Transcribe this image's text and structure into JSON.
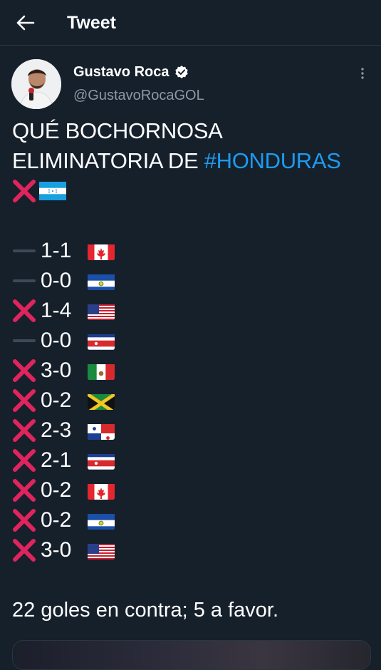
{
  "header": {
    "title": "Tweet",
    "back_icon": "arrow-left-icon"
  },
  "author": {
    "name": "Gustavo Roca",
    "handle": "@GustavoRocaGOL",
    "verified": true,
    "more_icon": "more-vertical-icon"
  },
  "tweet": {
    "line1": "QUÉ BOCHORNOSA",
    "line2_prefix": "ELIMINATORIA DE ",
    "hashtag": "#HONDURAS",
    "line3_icons": [
      "cross-mark-icon",
      "honduras-flag-icon"
    ],
    "results": [
      {
        "mark": "draw",
        "score": "1-1",
        "flag": "canada"
      },
      {
        "mark": "draw",
        "score": "0-0",
        "flag": "el-salvador"
      },
      {
        "mark": "loss",
        "score": "1-4",
        "flag": "usa"
      },
      {
        "mark": "draw",
        "score": "0-0",
        "flag": "costa-rica"
      },
      {
        "mark": "loss",
        "score": "3-0",
        "flag": "mexico"
      },
      {
        "mark": "loss",
        "score": "0-2",
        "flag": "jamaica"
      },
      {
        "mark": "loss",
        "score": "2-3",
        "flag": "panama"
      },
      {
        "mark": "loss",
        "score": "2-1",
        "flag": "costa-rica"
      },
      {
        "mark": "loss",
        "score": "0-2",
        "flag": "canada"
      },
      {
        "mark": "loss",
        "score": "0-2",
        "flag": "el-salvador"
      },
      {
        "mark": "loss",
        "score": "3-0",
        "flag": "usa"
      }
    ],
    "summary": "22 goles en contra; 5 a favor."
  },
  "colors": {
    "background": "#15202b",
    "text": "#ffffff",
    "secondary": "#8b98a5",
    "link": "#1d9bf0",
    "cross": "#e0245e"
  }
}
